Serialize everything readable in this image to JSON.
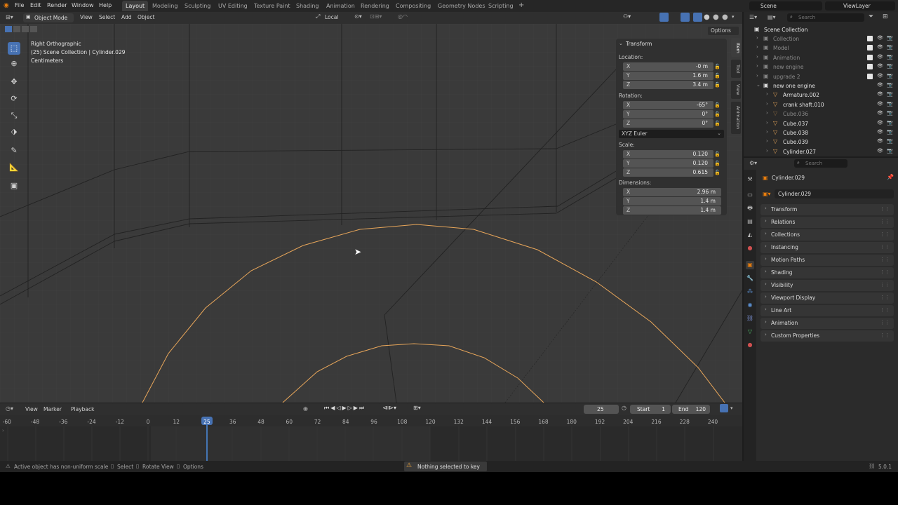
{
  "topbar": {
    "menus": [
      "File",
      "Edit",
      "Render",
      "Window",
      "Help"
    ],
    "workspaces": [
      "Layout",
      "Modeling",
      "Sculpting",
      "UV Editing",
      "Texture Paint",
      "Shading",
      "Animation",
      "Rendering",
      "Compositing",
      "Geometry Nodes",
      "Scripting"
    ],
    "active_workspace": "Layout",
    "scene": "Scene",
    "view_layer": "ViewLayer"
  },
  "viewport_header": {
    "mode": "Object Mode",
    "menus": [
      "View",
      "Select",
      "Add",
      "Object"
    ],
    "orientation": "Local",
    "options": "Options"
  },
  "viewport_info": {
    "view": "Right Orthographic",
    "collection": "(25) Scene Collection | Cylinder.029",
    "units": "Centimeters"
  },
  "npanel": {
    "title": "Transform",
    "location_label": "Location:",
    "location": [
      {
        "axis": "X",
        "value": "-0 m"
      },
      {
        "axis": "Y",
        "value": "1.6 m"
      },
      {
        "axis": "Z",
        "value": "3.4 m"
      }
    ],
    "rotation_label": "Rotation:",
    "rotation": [
      {
        "axis": "X",
        "value": "-65°"
      },
      {
        "axis": "Y",
        "value": "0°"
      },
      {
        "axis": "Z",
        "value": "0°"
      }
    ],
    "rotation_mode": "XYZ Euler",
    "scale_label": "Scale:",
    "scale": [
      {
        "axis": "X",
        "value": "0.120"
      },
      {
        "axis": "Y",
        "value": "0.120"
      },
      {
        "axis": "Z",
        "value": "0.615"
      }
    ],
    "dimensions_label": "Dimensions:",
    "dimensions": [
      {
        "axis": "X",
        "value": "2.96 m"
      },
      {
        "axis": "Y",
        "value": "1.4 m"
      },
      {
        "axis": "Z",
        "value": "1.4 m"
      }
    ],
    "tabs": [
      "Item",
      "Tool",
      "View",
      "Animation"
    ]
  },
  "outliner": {
    "search_placeholder": "Search",
    "root": "Scene Collection",
    "rows": [
      {
        "name": "Collection",
        "dim": true
      },
      {
        "name": "Model",
        "dim": true
      },
      {
        "name": "Animation",
        "dim": true
      },
      {
        "name": "new engine",
        "dim": true
      },
      {
        "name": "upgrade 2",
        "dim": true
      },
      {
        "name": "new one engine",
        "dim": false
      },
      {
        "name": "Armature.002",
        "dim": false
      },
      {
        "name": "crank shaft.010",
        "dim": false
      },
      {
        "name": "Cube.036",
        "dim": true
      },
      {
        "name": "Cube.037",
        "dim": false
      },
      {
        "name": "Cube.038",
        "dim": false
      },
      {
        "name": "Cube.039",
        "dim": false
      },
      {
        "name": "Cylinder.027",
        "dim": false
      }
    ]
  },
  "properties": {
    "search_placeholder": "Search",
    "object_name": "Cylinder.029",
    "object_field": "Cylinder.029",
    "panels": [
      "Transform",
      "Relations",
      "Collections",
      "Instancing",
      "Motion Paths",
      "Shading",
      "Visibility",
      "Viewport Display",
      "Line Art",
      "Animation",
      "Custom Properties"
    ]
  },
  "timeline": {
    "menus": [
      "View",
      "Marker",
      "Playback"
    ],
    "current_frame": "25",
    "start_label": "Start",
    "start": "1",
    "end_label": "End",
    "end": "120",
    "ticks": [
      "-60",
      "-48",
      "-36",
      "-24",
      "-12",
      "0",
      "12",
      "25",
      "36",
      "48",
      "60",
      "72",
      "84",
      "96",
      "108",
      "120",
      "132",
      "144",
      "156",
      "168",
      "180",
      "192",
      "204",
      "216",
      "228",
      "240"
    ]
  },
  "status": {
    "warning": "Active object has non-uniform scale",
    "select": "Select",
    "rotate": "Rotate View",
    "options": "Options",
    "message": "Nothing selected to key",
    "version": "5.0.1"
  },
  "colors": {
    "accent": "#4772b3",
    "selection_orange": "#e8a65a",
    "viewport_bg": "#3a3a3a"
  }
}
